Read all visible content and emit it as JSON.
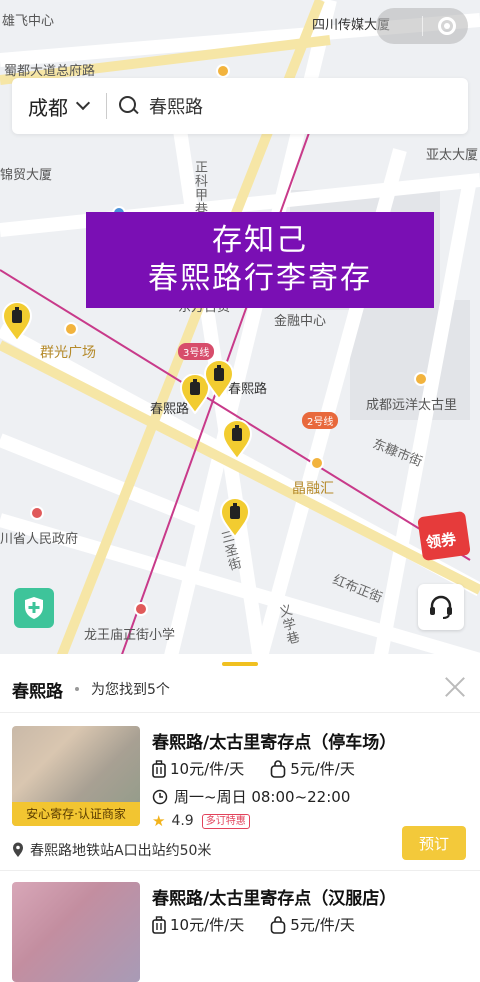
{
  "map": {
    "labels": {
      "top_left": "雄飞中心",
      "top_right": "四川传媒大厦",
      "shudu": "蜀都大道总府路",
      "yatai": "亚太大厦",
      "jinmao": "锦贸大厦",
      "qunguang": "群光广场",
      "jinrong": "金融中心",
      "yuanyang": "成都远洋太古里",
      "chunxi_station": "春熙路",
      "jingronghui": "晶融汇",
      "zhengfu": "川省人民政府",
      "longwang": "龙王庙正街小学",
      "dongda": "东糠市街",
      "hongbu": "红布正街",
      "sanjie": "三圣街",
      "yixue": "义学巷",
      "zhengke": "正科甲巷",
      "baihuo": "东方百货"
    },
    "line_badges": {
      "line3": "3号线",
      "line2": "2号线"
    }
  },
  "search": {
    "city": "成都",
    "query": "春熙路"
  },
  "banner": {
    "line1": "存知己",
    "line2": "春熙路行李寄存"
  },
  "coupon": {
    "label": "领券"
  },
  "sheet": {
    "title": "春熙路",
    "subtitle": "为您找到5个",
    "cards": [
      {
        "title": "春熙路/太古里寄存点（停车场）",
        "price_large": "10元/件/天",
        "price_small": "5元/件/天",
        "hours": "周一~周日 08:00~22:00",
        "rating": "4.9",
        "promo": "多订特惠",
        "tag": "安心寄存·认证商家",
        "address": "春熙路地铁站A口出站约50米",
        "book_label": "预订"
      },
      {
        "title": "春熙路/太古里寄存点（汉服店）",
        "price_large": "10元/件/天",
        "price_small": "5元/件/天"
      }
    ]
  },
  "colors": {
    "accent": "#f3c93a",
    "banner": "#7a0fb4",
    "metro3": "#d74d6b",
    "metro2": "#e8693c"
  }
}
